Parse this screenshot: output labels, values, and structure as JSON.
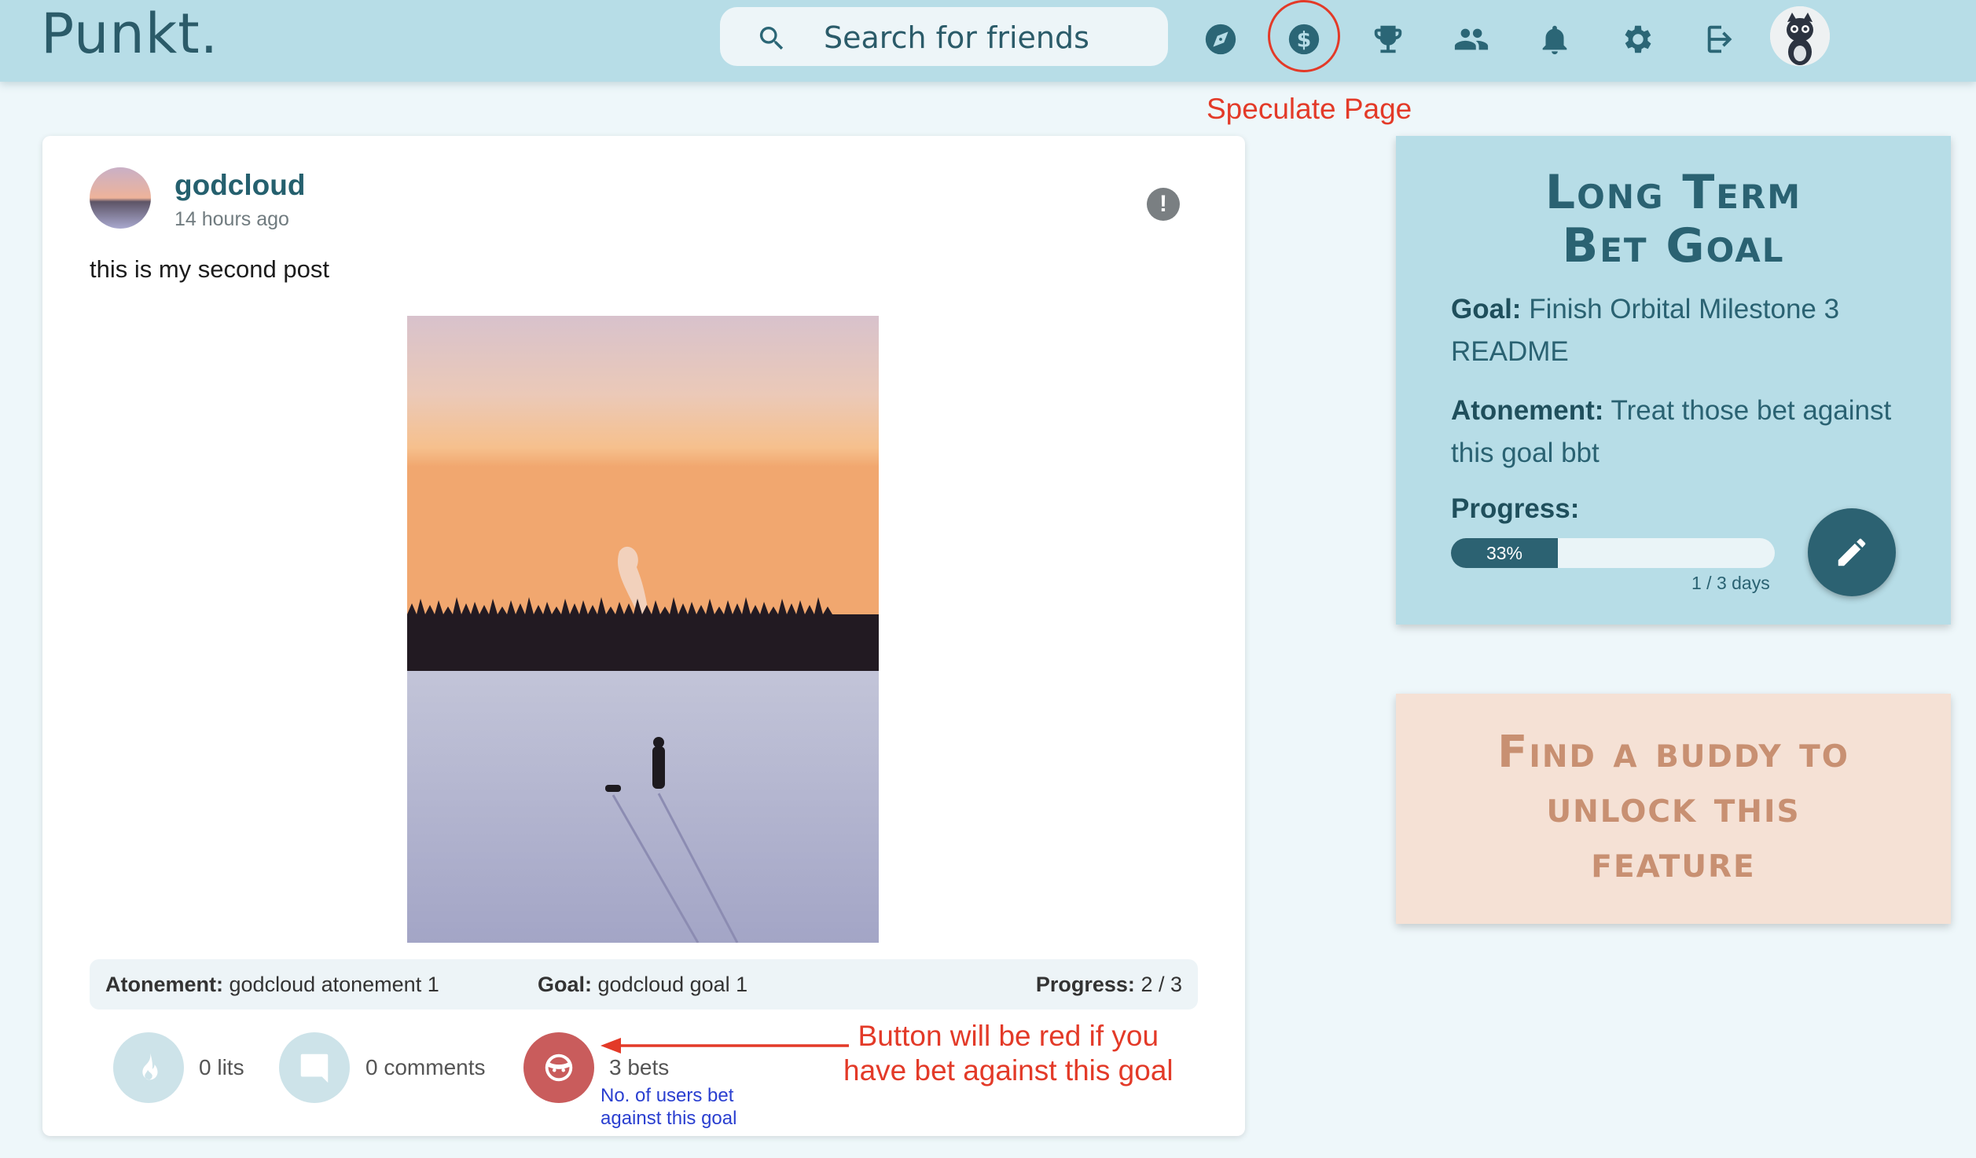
{
  "nav": {
    "brand": "Punkt.",
    "search_placeholder": "Search for friends",
    "icons": [
      "compass-icon",
      "dollar-icon",
      "trophy-icon",
      "friends-icon",
      "bell-icon",
      "gear-icon",
      "logout-icon",
      "avatar"
    ],
    "highlight_label": "Speculate Page",
    "accent": "#e33a28"
  },
  "post": {
    "username": "godcloud",
    "timestamp": "14 hours ago",
    "text": "this is my second post",
    "atonement_label": "Atonement:",
    "atonement_value": "godcloud atonement 1",
    "goal_label": "Goal:",
    "goal_value": "godcloud goal 1",
    "progress_label": "Progress:",
    "progress_value": "2 / 3",
    "lits": "0 lits",
    "comments": "0 comments",
    "bets": "3 bets",
    "bets_note_line1": "No. of users bet",
    "bets_note_line2": "against this goal",
    "annotation_line1": "Button will be red if you",
    "annotation_line2": "have bet against this goal"
  },
  "goal_panel": {
    "title_line1": "Long Term",
    "title_line2": "Bet Goal",
    "goal_label": "Goal:",
    "goal_value": "Finish Orbital Milestone 3 README",
    "atonement_label": "Atonement:",
    "atonement_value": "Treat those bet against this goal bbt",
    "progress_label": "Progress:",
    "progress_percent": "33%",
    "progress_fraction": 0.33,
    "days": "1 / 3 days"
  },
  "buddy_panel": {
    "line1": "Find a buddy to",
    "line2": "unlock this",
    "line3": "feature"
  }
}
